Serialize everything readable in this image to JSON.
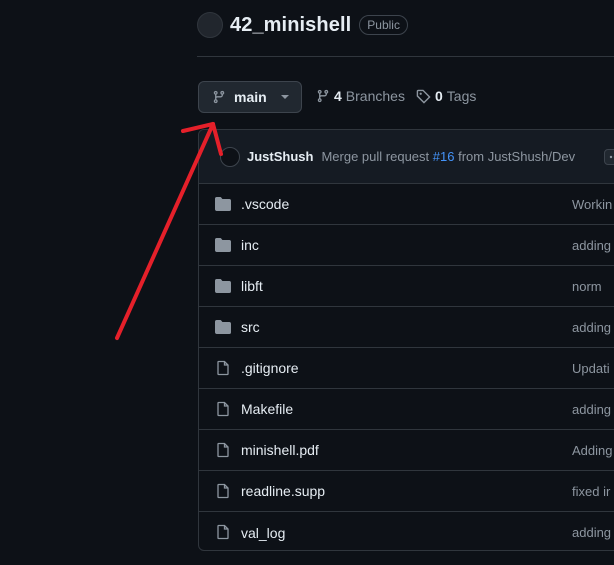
{
  "repo": {
    "name": "42_minishell",
    "visibility": "Public"
  },
  "branch": {
    "current": "main"
  },
  "counts": {
    "branches_count": "4",
    "branches_label": "Branches",
    "tags_count": "0",
    "tags_label": "Tags"
  },
  "latest_commit": {
    "author": "JustShush",
    "message_prefix": "Merge pull request",
    "pr_number": "#16",
    "message_suffix": "from JustShush/Dev"
  },
  "files": [
    {
      "name": ".vscode",
      "type": "folder",
      "commit": "Workin"
    },
    {
      "name": "inc",
      "type": "folder",
      "commit": "adding"
    },
    {
      "name": "libft",
      "type": "folder",
      "commit": "norm"
    },
    {
      "name": "src",
      "type": "folder",
      "commit": "adding"
    },
    {
      "name": ".gitignore",
      "type": "file",
      "commit": "Updati"
    },
    {
      "name": "Makefile",
      "type": "file",
      "commit": "adding"
    },
    {
      "name": "minishell.pdf",
      "type": "file",
      "commit": "Adding"
    },
    {
      "name": "readline.supp",
      "type": "file",
      "commit": "fixed ir"
    },
    {
      "name": "val_log",
      "type": "file",
      "commit": "adding"
    }
  ],
  "colors": {
    "background": "#0d1117",
    "accent_link": "#4493f8",
    "annotation_arrow": "#e5202a",
    "folder_icon": "#8d96a0"
  },
  "icons": {
    "branch": "git-branch-icon",
    "tag": "tag-icon",
    "folder": "folder-icon",
    "file": "file-icon",
    "caret": "triangle-down-icon"
  }
}
